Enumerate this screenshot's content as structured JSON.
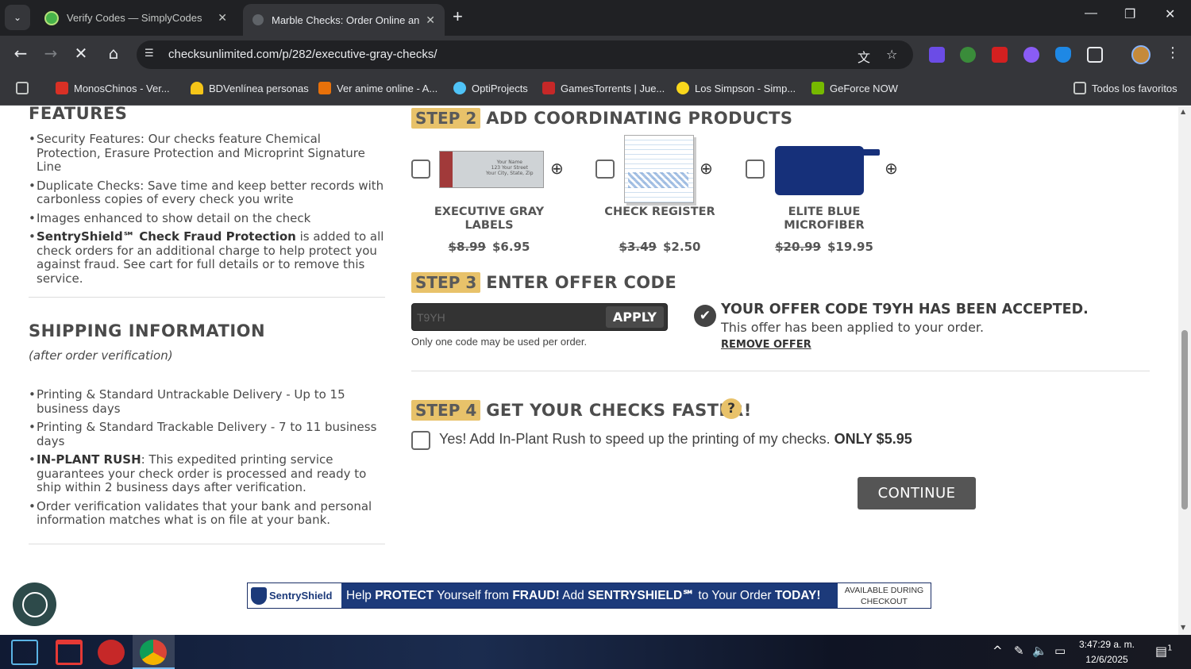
{
  "browser": {
    "tabs": [
      {
        "title": "Verify Codes — SimplyCodes",
        "active": false
      },
      {
        "title": "Marble Checks: Order Online an",
        "active": true
      }
    ],
    "url": "checksunlimited.com/p/282/executive-gray-checks/",
    "bookmarks": [
      "MonosChinos - Ver...",
      "BDVenlínea personas",
      "Ver anime online - A...",
      "OptiProjects",
      "GamesTorrents | Jue...",
      "Los Simpson - Simp...",
      "GeForce NOW"
    ],
    "all_bookmarks": "Todos los favoritos"
  },
  "left": {
    "features_heading": "FEATURES",
    "features": [
      {
        "bold": "",
        "text": "Security Features: Our checks feature Chemical Protection, Erasure Protection and Microprint Signature Line"
      },
      {
        "bold": "",
        "text": "Duplicate Checks: Save time and keep better records with carbonless copies of every check you write"
      },
      {
        "bold": "",
        "text": "Images enhanced to show detail on the check"
      },
      {
        "bold": "SentryShield℠ Check Fraud Protection",
        "text": " is added to all check orders for an additional charge to help protect you against fraud. See cart for full details or to remove this service."
      }
    ],
    "shipping_heading": "SHIPPING INFORMATION",
    "shipping_sub": "(after order verification)",
    "shipping": [
      {
        "bold": "",
        "text": "Printing & Standard Untrackable Delivery - Up to 15 business days"
      },
      {
        "bold": "",
        "text": "Printing & Standard Trackable Delivery - 7 to 11 business days"
      },
      {
        "bold": "IN-PLANT RUSH",
        "text": ": This expedited printing service guarantees your check order is processed and ready to ship within 2 business days after verification."
      },
      {
        "bold": "",
        "text": "Order verification validates that your bank and personal information matches what is on file at your bank."
      }
    ]
  },
  "step2": {
    "badge": "STEP 2",
    "label": "ADD COORDINATING PRODUCTS",
    "products": [
      {
        "name": "EXECUTIVE GRAY LABELS",
        "old_price": "$8.99",
        "price": "$6.95",
        "image_text": "Your Name\n123 Your Street\nYour City, State, Zip"
      },
      {
        "name": "CHECK REGISTER",
        "old_price": "$3.49",
        "price": "$2.50"
      },
      {
        "name": "ELITE BLUE MICROFIBER",
        "old_price": "$20.99",
        "price": "$19.95"
      }
    ]
  },
  "step3": {
    "badge": "STEP 3",
    "label": "ENTER OFFER CODE",
    "code_value": "T9YH",
    "apply": "APPLY",
    "note": "Only one code may be used per order.",
    "accepted": "YOUR OFFER CODE T9YH HAS BEEN ACCEPTED.",
    "applied": "This offer has been applied to your order.",
    "remove": "REMOVE OFFER"
  },
  "step4": {
    "badge": "STEP 4",
    "label": "GET YOUR CHECKS FASTER!",
    "help": "?",
    "rush_text": "Yes! Add In-Plant Rush to speed up the printing of my checks.",
    "rush_price": "ONLY $5.95"
  },
  "continue": "CONTINUE",
  "banner": {
    "logo": "SentryShield",
    "message_parts": [
      "Help ",
      "PROTECT",
      " Yourself from ",
      "FRAUD!",
      " Add ",
      "SENTRYSHIELD℠",
      " to Your Order ",
      "TODAY!"
    ],
    "avail_line1": "AVAILABLE DURING",
    "avail_line2": "CHECKOUT"
  },
  "taskbar": {
    "time": "3:47:29 a. m.",
    "date": "12/6/2025",
    "notifications": "1"
  }
}
